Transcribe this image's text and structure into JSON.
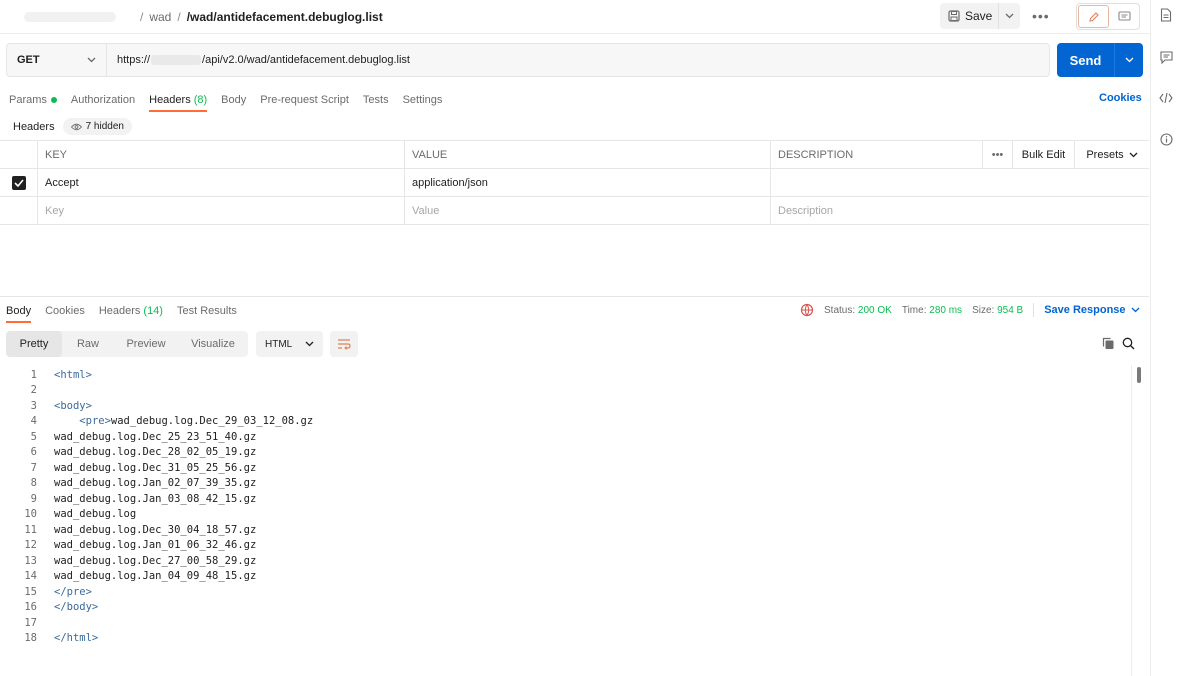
{
  "breadcrumb": {
    "parent": "wad",
    "current": "/wad/antidefacement.debuglog.list"
  },
  "toolbar": {
    "save_label": "Save"
  },
  "request": {
    "method": "GET",
    "url_prefix": "https://",
    "url_suffix": "/api/v2.0/wad/antidefacement.debuglog.list",
    "send_label": "Send"
  },
  "request_tabs": {
    "params": "Params",
    "authorization": "Authorization",
    "headers": "Headers",
    "headers_count": "(8)",
    "body": "Body",
    "prerequest": "Pre-request Script",
    "tests": "Tests",
    "settings": "Settings",
    "cookies": "Cookies"
  },
  "headers_section": {
    "label": "Headers",
    "hidden": "7 hidden"
  },
  "headers_table": {
    "columns": {
      "key": "KEY",
      "value": "VALUE",
      "description": "DESCRIPTION",
      "bulk_edit": "Bulk Edit",
      "presets": "Presets"
    },
    "rows": [
      {
        "key": "Accept",
        "value": "application/json",
        "description": ""
      }
    ],
    "placeholders": {
      "key": "Key",
      "value": "Value",
      "description": "Description"
    }
  },
  "response_tabs": {
    "body": "Body",
    "cookies": "Cookies",
    "headers": "Headers",
    "headers_count": "(14)",
    "test_results": "Test Results"
  },
  "response_status": {
    "status_label": "Status:",
    "status_value": "200 OK",
    "time_label": "Time:",
    "time_value": "280 ms",
    "size_label": "Size:",
    "size_value": "954 B",
    "save_response": "Save Response"
  },
  "view_modes": {
    "pretty": "Pretty",
    "raw": "Raw",
    "preview": "Preview",
    "visualize": "Visualize",
    "format": "HTML"
  },
  "code_lines": [
    "<html>",
    "",
    "<body>",
    "    <pre>wad_debug.log.Dec_29_03_12_08.gz",
    "wad_debug.log.Dec_25_23_51_40.gz",
    "wad_debug.log.Dec_28_02_05_19.gz",
    "wad_debug.log.Dec_31_05_25_56.gz",
    "wad_debug.log.Jan_02_07_39_35.gz",
    "wad_debug.log.Jan_03_08_42_15.gz",
    "wad_debug.log",
    "wad_debug.log.Dec_30_04_18_57.gz",
    "wad_debug.log.Jan_01_06_32_46.gz",
    "wad_debug.log.Dec_27_00_58_29.gz",
    "wad_debug.log.Jan_04_09_48_15.gz",
    "</pre>",
    "</body>",
    "",
    "</html>"
  ],
  "colors": {
    "accent": "#ff6c37",
    "primary": "#0265d2",
    "success": "#0cbb52"
  }
}
